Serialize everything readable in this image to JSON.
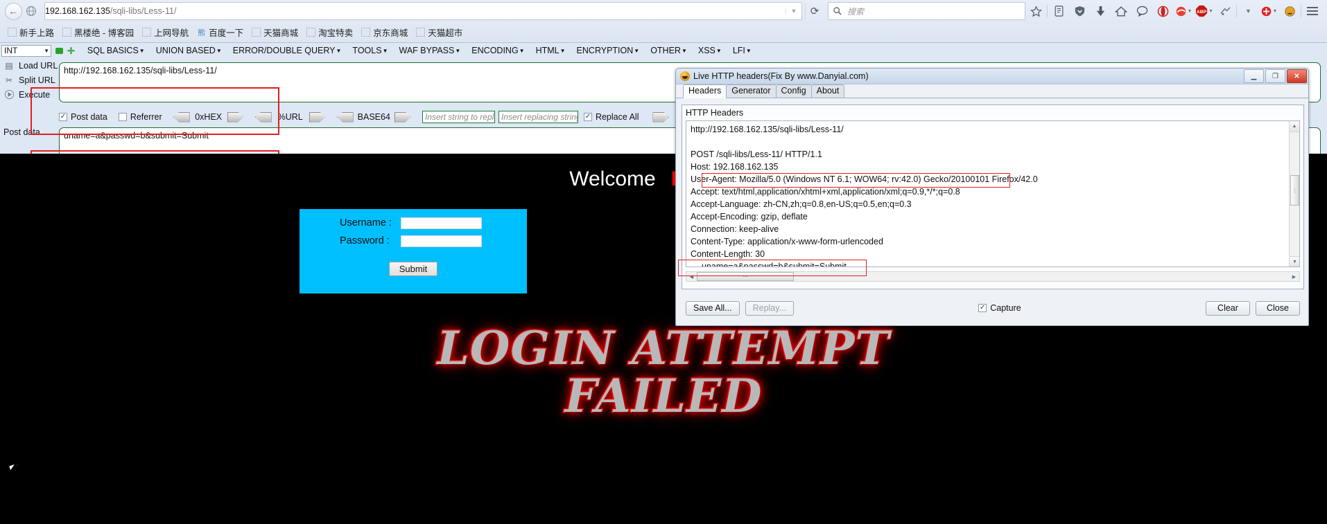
{
  "browser": {
    "url_host": "192.168.162.135",
    "url_path": "/sqli-libs/Less-11/",
    "search_placeholder": "搜索",
    "back_icon": "back-arrow-icon",
    "bookmarks": [
      {
        "label": "新手上路",
        "icon": "bookmark-icon"
      },
      {
        "label": "黑楼绝 - 博客园",
        "icon": "bookmark-icon"
      },
      {
        "label": "上网导航",
        "icon": "bookmark-icon"
      },
      {
        "label": "百度一下",
        "icon": "baidu-icon"
      },
      {
        "label": "天猫商城",
        "icon": "bookmark-icon"
      },
      {
        "label": "淘宝特卖",
        "icon": "bookmark-icon"
      },
      {
        "label": "京东商城",
        "icon": "bookmark-icon"
      },
      {
        "label": "天猫超市",
        "icon": "bookmark-icon"
      }
    ],
    "toolbar_icons": [
      "star-icon",
      "reader-icon",
      "shield-down-icon",
      "download-icon",
      "home-icon",
      "chat-icon",
      "opera-icon",
      "flashget-icon",
      "adblock-plus-icon",
      "thunder-icon",
      "add-on-icon",
      "account-icon",
      "hamburger-menu-icon"
    ]
  },
  "hackbar": {
    "type_select": "INT",
    "menus": [
      "SQL BASICS",
      "UNION BASED",
      "ERROR/DOUBLE QUERY",
      "TOOLS",
      "WAF BYPASS",
      "ENCODING",
      "HTML",
      "ENCRYPTION",
      "OTHER",
      "XSS",
      "LFI"
    ],
    "actions": [
      {
        "label": "Load URL",
        "icon": "load-url-icon"
      },
      {
        "label": "Split URL",
        "icon": "split-url-icon"
      },
      {
        "label": "Execute",
        "icon": "execute-icon"
      }
    ],
    "url_value": "http://192.168.162.135/sqli-libs/Less-11/",
    "post_data_label": "Post data",
    "post_data_value": "uname=a&passwd=b&submit=Submit",
    "options": {
      "post_data_label": "Post data",
      "post_data_checked": true,
      "referrer_label": "Referrer",
      "referrer_checked": false,
      "hex_label": "0xHEX",
      "url_label": "%URL",
      "base64_label": "BASE64",
      "replace_from_placeholder": "Insert string to replace",
      "replace_to_placeholder": "Insert replacing string",
      "replace_all_label": "Replace All",
      "replace_all_checked": true
    }
  },
  "page": {
    "welcome_text": "Welcome",
    "welcome_name": "Dhakkan",
    "username_label": "Username :",
    "password_label": "Password :",
    "username_value": "",
    "password_value": "",
    "submit_label": "Submit",
    "fail_line1": "LOGIN ATTEMPT",
    "fail_line2": "FAILED",
    "box_color": "#00bfff",
    "name_color": "#ff0000"
  },
  "live_http": {
    "title": "Live HTTP headers(Fix By www.Danyial.com)",
    "window_buttons": [
      "minimize-button",
      "maximize-button",
      "close-button"
    ],
    "tabs": [
      {
        "label": "Headers",
        "active": true
      },
      {
        "label": "Generator",
        "active": false
      },
      {
        "label": "Config",
        "active": false
      },
      {
        "label": "About",
        "active": false
      }
    ],
    "group_label": "HTTP Headers",
    "header_lines": [
      {
        "text": "http://192.168.162.135/sqli-libs/Less-11/",
        "highlight": false,
        "indent": false
      },
      {
        "text": "",
        "highlight": false,
        "indent": false
      },
      {
        "text": "POST /sqli-libs/Less-11/ HTTP/1.1",
        "highlight": false,
        "indent": false
      },
      {
        "text": "Host: 192.168.162.135",
        "highlight": false,
        "indent": false
      },
      {
        "text": "User-Agent: Mozilla/5.0 (Windows NT 6.1; WOW64; rv:42.0) Gecko/20100101 Firefox/42.0",
        "highlight": true,
        "indent": false
      },
      {
        "text": "Accept: text/html,application/xhtml+xml,application/xml;q=0.9,*/*;q=0.8",
        "highlight": false,
        "indent": false
      },
      {
        "text": "Accept-Language: zh-CN,zh;q=0.8,en-US;q=0.5,en;q=0.3",
        "highlight": false,
        "indent": false
      },
      {
        "text": "Accept-Encoding: gzip, deflate",
        "highlight": false,
        "indent": false
      },
      {
        "text": "Connection: keep-alive",
        "highlight": false,
        "indent": false
      },
      {
        "text": "Content-Type: application/x-www-form-urlencoded",
        "highlight": false,
        "indent": false
      },
      {
        "text": "Content-Length: 30",
        "highlight": false,
        "indent": false
      },
      {
        "text": "uname=a&passwd=b&submit=Submit",
        "highlight": true,
        "indent": true
      }
    ],
    "buttons": {
      "save_all": "Save All...",
      "replay": "Replay...",
      "capture_label": "Capture",
      "capture_checked": true,
      "clear": "Clear",
      "close": "Close"
    }
  }
}
